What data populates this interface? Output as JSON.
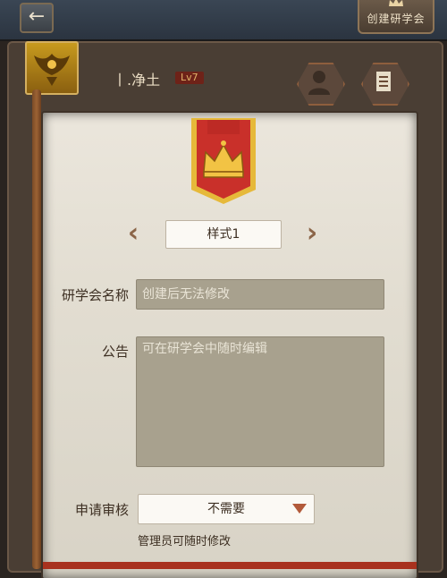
{
  "header": {
    "back_icon": "arrow-left-icon",
    "back_glyph": "←",
    "create_label": "创建研学会"
  },
  "profile": {
    "username": "丨.净土",
    "level": "Lv7"
  },
  "emblem": {
    "icon": "crown-banner-icon",
    "colors": {
      "banner": "#c9302a",
      "trim": "#e6b93a",
      "crown": "#f2c344"
    }
  },
  "style_selector": {
    "prev_glyph": "‹",
    "next_glyph": "›",
    "value": "样式1"
  },
  "form": {
    "name_label": "研学会名称",
    "name_placeholder": "创建后无法修改",
    "notice_label": "公告",
    "notice_placeholder": "可在研学会中随时编辑",
    "review_label": "申请审核",
    "review_value": "不需要",
    "review_hint": "管理员可随时修改"
  }
}
